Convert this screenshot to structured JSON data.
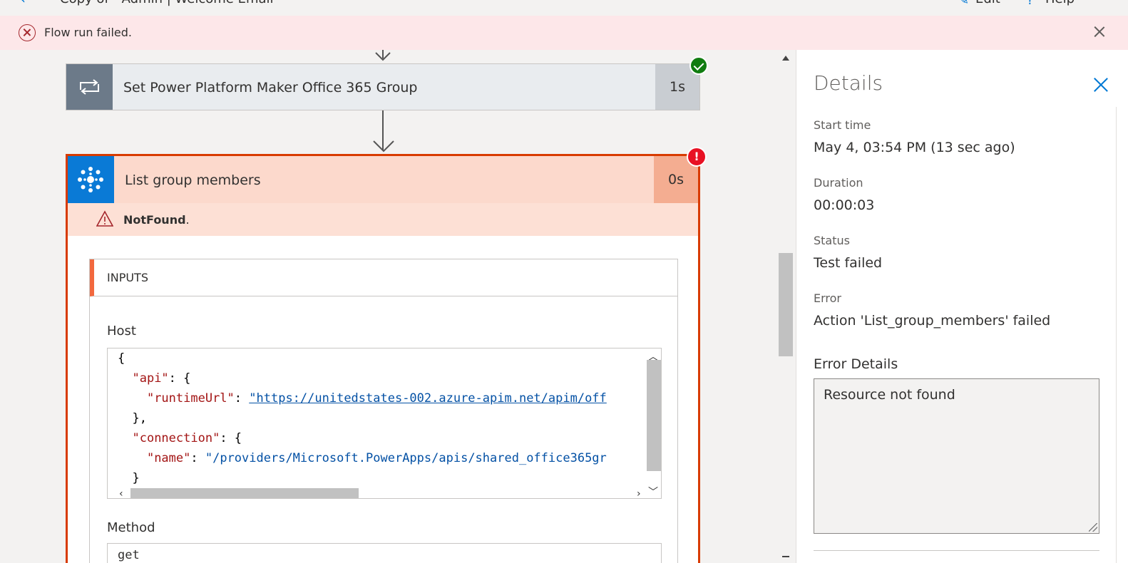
{
  "topbar": {
    "title": "Copy of - Admin | Welcome Email",
    "edit_label": "Edit",
    "help_label": "Help"
  },
  "banner": {
    "message": "Flow run failed."
  },
  "flow": {
    "action1": {
      "label": "Set Power Platform Maker Office 365 Group",
      "duration": "1s",
      "status": "succeeded"
    },
    "action2": {
      "label": "List group members",
      "duration": "0s",
      "status": "failed",
      "error_code": "NotFound",
      "error_suffix": ".",
      "inputs_title": "INPUTS",
      "host_label": "Host",
      "method_label": "Method",
      "method_value": "get",
      "code": {
        "line1": "{",
        "api_key": "\"api\"",
        "runtime_key": "\"runtimeUrl\"",
        "runtime_value": "\"https://unitedstates-002.azure-apim.net/apim/off",
        "close_obj": "},",
        "connection_key": "\"connection\"",
        "name_key": "\"name\"",
        "name_value": "\"/providers/Microsoft.PowerApps/apis/shared_office365gr",
        "close_brace": "}"
      }
    }
  },
  "details": {
    "title": "Details",
    "start_time_label": "Start time",
    "start_time_value": "May 4, 03:54 PM (13 sec ago)",
    "duration_label": "Duration",
    "duration_value": "00:00:03",
    "status_label": "Status",
    "status_value": "Test failed",
    "error_label": "Error",
    "error_value": "Action 'List_group_members' failed",
    "error_details_label": "Error Details",
    "error_details_value": "Resource not found"
  },
  "colors": {
    "accent": "#0078d4",
    "error_border": "#d83b01",
    "success": "#107c10",
    "error_badge": "#e81123"
  }
}
